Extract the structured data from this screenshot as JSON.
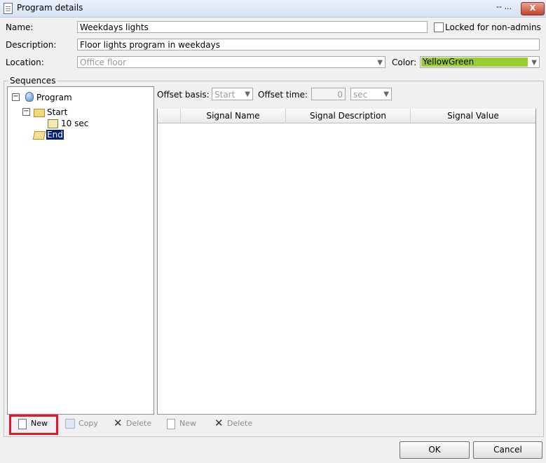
{
  "window": {
    "title": "Program details",
    "minimize_label": "-- ...",
    "close_label": "X"
  },
  "form": {
    "name_label": "Name:",
    "name_value": "Weekdays lights",
    "locked_label": "Locked for non-admins",
    "description_label": "Description:",
    "description_value": "Floor lights program in weekdays",
    "location_label": "Location:",
    "location_value": "Office floor",
    "color_label": "Color:",
    "color_value": "YellowGreen",
    "color_hex": "#9acd32"
  },
  "sequences": {
    "group_title": "Sequences",
    "tree": {
      "program": "Program",
      "start": "Start",
      "step": "10 sec",
      "end": "End"
    },
    "offset_basis_label": "Offset basis:",
    "offset_basis_value": "Start",
    "offset_time_label": "Offset time:",
    "offset_time_value": "0",
    "offset_unit_value": "sec",
    "grid_headers": [
      "Signal Name",
      "Signal Description",
      "Signal Value"
    ]
  },
  "left_toolbar": {
    "new_label": "New",
    "copy_label": "Copy",
    "delete_label": "Delete"
  },
  "right_toolbar": {
    "new_label": "New",
    "delete_label": "Delete"
  },
  "dialog": {
    "ok_label": "OK",
    "cancel_label": "Cancel"
  },
  "colors": {
    "highlight": "#e5152c",
    "selection": "#001f7a"
  }
}
